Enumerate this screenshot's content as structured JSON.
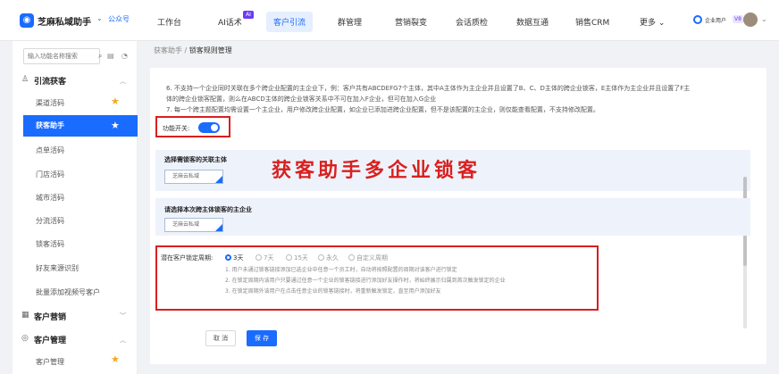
{
  "app": {
    "brand": "芝麻私域助手",
    "account_type": "公众号"
  },
  "nav": {
    "items": [
      "工作台",
      "AI话术",
      "客户引流",
      "群管理",
      "营销裂变",
      "会话质检",
      "数据互通",
      "销售CRM",
      "更多"
    ],
    "active": "客户引流",
    "ai_badge": "AI"
  },
  "user": {
    "name": "企业用户",
    "badge": "V8"
  },
  "sidebar": {
    "search_placeholder": "输入功能名称搜索",
    "groups": [
      {
        "label": "引流获客",
        "items": [
          "渠道活码",
          "获客助手",
          "点单活码",
          "门店活码",
          "城市活码",
          "分流活码",
          "锁客活码",
          "好友来源识别",
          "批量添加视频号客户"
        ]
      },
      {
        "label": "客户营销"
      },
      {
        "label": "客户管理",
        "items": [
          "客户管理"
        ]
      }
    ],
    "active_item": "获客助手"
  },
  "breadcrumb": {
    "parent": "获客助手",
    "separator": "/",
    "current": "锁客规则管理"
  },
  "content": {
    "desc_lines": [
      "6. 不支持一个企业同时关联在多个跨企业配置的主企业下，例：客户共有ABCDEFG7个主体，其中A主体作为主企业并且设置了B、C、D主体的跨企业锁客，E主体作为主企业并且设置了F主",
      "体的跨企业锁客配置，则么在ABCD主体的跨企业锁客关系中不可在加入F企业，但可在加入G企业",
      "7. 每一个跨主题配置均需设置一个主企业，用户修改跨企业配置，如企业已添加进跨企业配置，但不是该配置的主企业，则仅能查看配置，不支持修改配置。"
    ],
    "feature_switch_label": "功能开关:",
    "big_title": "获客助手多企业锁客",
    "section1": {
      "title": "选择需锁客的关联主体",
      "select_value": "芝麻云私域"
    },
    "section2": {
      "title": "请选择本次跨主体锁客的主企业",
      "select_value": "芝麻云私域"
    },
    "period": {
      "label": "潜在客户锁定周期:",
      "options": [
        "3天",
        "7天",
        "15天",
        "永久",
        "自定义周期"
      ],
      "selected": "3天",
      "notes": [
        "1. 用户未通过锁客链接添加已选企业中任意一个员工时，自动将按照配置的周期对该客户进行锁定",
        "2. 在锁定周期内该用户只要通过任意一个企业的锁客链接进行添加好友操作时，将始终展示归属到首次触发锁定的企业",
        "3. 在锁定周期外该用户在点击任意企业的锁客链接时，将重新触发锁定，直至用户添加好友"
      ]
    },
    "cancel_label": "取 消",
    "save_label": "保 存"
  },
  "colors": {
    "primary": "#1a6bff",
    "highlight_red": "#d9201f",
    "section_bg": "#eef3fb",
    "star": "#f5a623"
  }
}
